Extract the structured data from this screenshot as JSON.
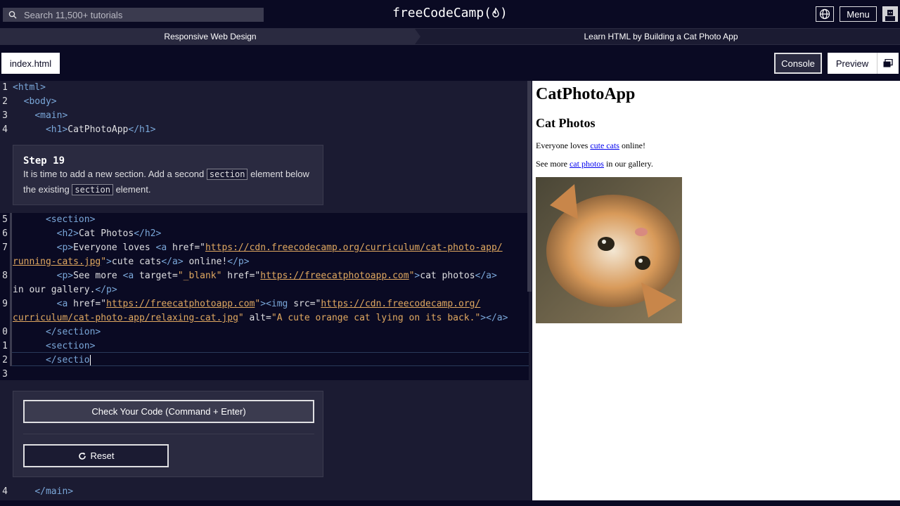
{
  "nav": {
    "search_placeholder": "Search 11,500+ tutorials",
    "logo_text": "freeCodeCamp(",
    "logo_close": ")",
    "menu_label": "Menu"
  },
  "breadcrumbs": {
    "course": "Responsive Web Design",
    "project": "Learn HTML by Building a Cat Photo App"
  },
  "tabs": {
    "file": "index.html",
    "console": "Console",
    "preview": "Preview"
  },
  "editor": {
    "line_numbers": [
      "1",
      "2",
      "3",
      "4",
      "5",
      "6",
      "7",
      "",
      "8",
      "",
      "9",
      "",
      "0",
      "1",
      "2",
      "3",
      "4"
    ],
    "l1_tag": "<html>",
    "l2_tag": "<body>",
    "l3_tag": "<main>",
    "l4_open": "<h1>",
    "l4_text": "CatPhotoApp",
    "l4_close": "</h1>",
    "l5_tag": "<section>",
    "l6_open": "<h2>",
    "l6_text": "Cat Photos",
    "l6_close": "</h2>",
    "l7_p": "<p>",
    "l7_text1": "Everyone loves ",
    "l7_a": "<a ",
    "l7_attr": "href",
    "l7_eq": "=\"",
    "l7_url1": "https://cdn.freecodecamp.org/curriculum/cat-photo-app/",
    "l7_url2": "running-cats.jpg",
    "l7_q": "\"",
    "l7_gt": ">",
    "l7_link": "cute cats",
    "l7_aclose": "</a>",
    "l7_text2": " online!",
    "l7_pclose": "</p>",
    "l8_p": "<p>",
    "l8_text1": "See more ",
    "l8_a": "<a ",
    "l8_attr1": "target",
    "l8_eq1": "=",
    "l8_val1": "\"_blank\"",
    "l8_attr2": " href",
    "l8_eq2": "=\"",
    "l8_url": "https://freecatphotoapp.com",
    "l8_q": "\"",
    "l8_gt": ">",
    "l8_link": "cat photos",
    "l8_aclose": "</a>",
    "l8_text2": "in our gallery.",
    "l8_pclose": "</p>",
    "l9_a": "<a ",
    "l9_attr": "href",
    "l9_eq": "=\"",
    "l9_url": "https://freecatphotoapp.com",
    "l9_q": "\"",
    "l9_gt": ">",
    "l9_img": "<img ",
    "l9_attr2": "src",
    "l9_eq2": "=\"",
    "l9_src1": "https://cdn.freecodecamp.org/",
    "l9_src2": "curriculum/cat-photo-app/relaxing-cat.jpg",
    "l9_q2": "\"",
    "l9_attr3": " alt",
    "l9_eq3": "=",
    "l9_alt": "\"A cute orange cat lying on its back.\"",
    "l9_end": "></a>",
    "l10_tag": "</section>",
    "l11_tag": "<section>",
    "l12_text": "</sectio",
    "l14_tag": "</main>"
  },
  "step": {
    "title": "Step 19",
    "text1": "It is time to add a new section. Add a second ",
    "code1": "section",
    "text2": " element below the existing ",
    "code2": "section",
    "text3": " element."
  },
  "actions": {
    "check_label": "Check Your Code (Command + Enter)",
    "reset_label": "Reset"
  },
  "preview": {
    "h1": "CatPhotoApp",
    "h2": "Cat Photos",
    "p1_before": "Everyone loves ",
    "p1_link": "cute cats",
    "p1_after": " online!",
    "p2_before": "See more ",
    "p2_link": "cat photos",
    "p2_after": " in our gallery."
  },
  "colors": {
    "bg": "#0a0a23",
    "panel": "#1b1b32",
    "tag": "#7aa7d9",
    "string": "#e0a860",
    "link": "#0000ee"
  }
}
